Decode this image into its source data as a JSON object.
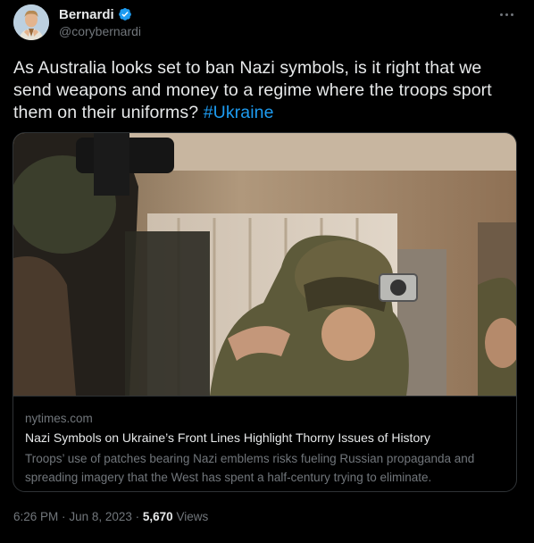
{
  "author": {
    "display_name": "Bernardi",
    "handle": "@corybernardi",
    "verified": true,
    "avatar_icon": "avatar-portrait"
  },
  "tweet": {
    "text": "As Australia looks set to ban Nazi symbols, is it right that we send weapons and money to a regime where the troops sport them on their uniforms?",
    "hashtag": "#Ukraine"
  },
  "card": {
    "domain": "nytimes.com",
    "title": "Nazi Symbols on Ukraine’s Front Lines Highlight Thorny Issues of History",
    "description": "Troops’ use of patches bearing Nazi emblems risks fueling Russian propaganda and spreading imagery that the West has spent a half-century trying to eliminate.",
    "image_icon": "soldiers-photo"
  },
  "meta": {
    "time": "6:26 PM",
    "separator": "·",
    "date": "Jun 8, 2023",
    "views_count": "5,670",
    "views_label": "Views"
  },
  "colors": {
    "background": "#000000",
    "text": "#e7e9ea",
    "secondary": "#71767b",
    "accent": "#1d9bf0",
    "border": "#2f3336"
  }
}
